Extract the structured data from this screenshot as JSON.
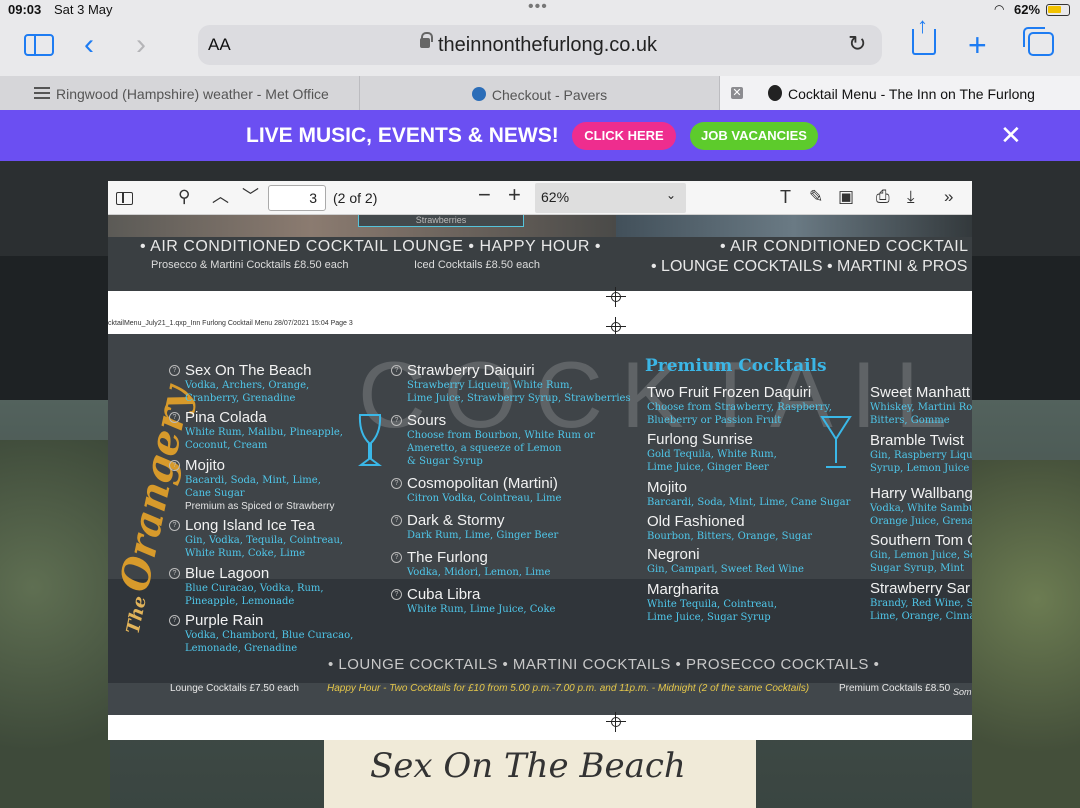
{
  "status": {
    "time": "09:03",
    "date": "Sat 3 May",
    "battery": "62%"
  },
  "browser": {
    "text_size": "AA",
    "url": "theinnonthefurlong.co.uk",
    "tabs": [
      {
        "label": "Ringwood (Hampshire) weather - Met Office"
      },
      {
        "label": "Checkout - Pavers"
      },
      {
        "label": "Cocktail Menu - The Inn on The Furlong"
      }
    ]
  },
  "promo": {
    "title": "LIVE MUSIC, EVENTS & NEWS!",
    "click_here": "CLICK HERE",
    "job_vacancies": "JOB VACANCIES"
  },
  "pdf": {
    "page": "3",
    "page_count": "(2 of 2)",
    "zoom": "62%",
    "slug": "cktailMenu_July21_1.qxp_Inn Furlong Cocktail Menu  28/07/2021  15:04  Page 3",
    "page2": {
      "box_text": "Strawberries",
      "line_left": "• AIR CONDITIONED COCKTAIL LOUNGE • HAPPY HOUR •",
      "sub_left": "Prosecco & Martini Cocktails £8.50 each",
      "sub_mid": "Iced Cocktails £8.50 each",
      "line_right": "• AIR CONDITIONED COCKTAIL LO",
      "line_right2": "• LOUNGE COCKTAILS • MARTINI & PROS"
    },
    "menu": {
      "brand_small": "The",
      "brand_big": "Orangery",
      "watermark": "COCKTAIL LOUN",
      "premium_title": "Premium Cocktails",
      "col1": [
        {
          "name": "Sex On The Beach",
          "desc": "Vodka, Archers, Orange,",
          "desc2": "Cranberry, Grenadine"
        },
        {
          "name": "Pina Colada",
          "desc": "White Rum, Malibu, Pineapple,",
          "desc2": "Coconut, Cream"
        },
        {
          "name": "Mojito",
          "desc": "Bacardi, Soda, Mint, Lime,",
          "desc2": "Cane Sugar",
          "note": "Premium as Spiced or Strawberry"
        },
        {
          "name": "Long Island Ice Tea",
          "desc": "Gin, Vodka, Tequila, Cointreau,",
          "desc2": "White Rum, Coke, Lime"
        },
        {
          "name": "Blue Lagoon",
          "desc": "Blue Curacao, Vodka, Rum,",
          "desc2": "Pineapple, Lemonade"
        },
        {
          "name": "Purple Rain",
          "desc": "Vodka, Chambord, Blue Curacao,",
          "desc2": "Lemonade, Grenadine"
        }
      ],
      "col2": [
        {
          "name": "Strawberry Daiquiri",
          "desc": "Strawberry Liqueur, White Rum,",
          "desc2": "Lime Juice, Strawberry Syrup, Strawberries"
        },
        {
          "name": "Sours",
          "desc": "Choose from Bourbon, White Rum or",
          "desc2": "Ameretto, a squeeze of Lemon",
          "desc3": "& Sugar Syrup"
        },
        {
          "name": "Cosmopolitan (Martini)",
          "desc": "Citron Vodka, Cointreau, Lime"
        },
        {
          "name": "Dark & Stormy",
          "desc": "Dark Rum, Lime, Ginger Beer"
        },
        {
          "name": "The Furlong",
          "desc": "Vodka, Midori, Lemon, Lime"
        },
        {
          "name": "Cuba Libra",
          "desc": "White Rum, Lime Juice, Coke"
        }
      ],
      "col3": [
        {
          "name": "Two Fruit Frozen Daquiri",
          "desc": "Choose from Strawberry, Raspberry,",
          "desc2": "Blueberry or Passion Fruit"
        },
        {
          "name": "Furlong Sunrise",
          "desc": "Gold Tequila, White Rum,",
          "desc2": "Lime Juice, Ginger Beer"
        },
        {
          "name": "Mojito",
          "desc": "Barcardi, Soda, Mint, Lime, Cane Sugar"
        },
        {
          "name": "Old Fashioned",
          "desc": "Bourbon, Bitters, Orange, Sugar"
        },
        {
          "name": "Negroni",
          "desc": "Gin, Campari, Sweet Red Wine"
        },
        {
          "name": "Margharita",
          "desc": "White Tequila, Cointreau,",
          "desc2": "Lime Juice, Sugar Syrup"
        }
      ],
      "col4": [
        {
          "name": "Sweet Manhatt",
          "desc": "Whiskey, Martini Ross",
          "desc2": "Bitters, Gomme"
        },
        {
          "name": "Bramble Twist",
          "desc": "Gin, Raspberry Lique",
          "desc2": "Syrup, Lemon Juice"
        },
        {
          "name": "Harry Wallbang",
          "desc": "Vodka, White Sambu",
          "desc2": "Orange Juice, Grenad"
        },
        {
          "name": "Southern Tom C",
          "desc": "Gin, Lemon Juice, Soc",
          "desc2": "Sugar Syrup, Mint"
        },
        {
          "name": "Strawberry Sar",
          "desc": "Brandy, Red Wine, Str",
          "desc2": "Lime, Orange, Cinnan"
        }
      ],
      "bottom_line": "• LOUNGE COCKTAILS  •  MARTINI COCKTAILS  •  PROSECCO COCKTAILS  •",
      "foot_lounge": "Lounge Cocktails £7.50 each",
      "foot_happy": "Happy Hour - Two Cocktails for £10 from 5.00 p.m.-7.00 p.m. and 11p.m. - Midnight (2 of the same Cocktails)",
      "foot_premium": "Premium Cocktails £8.50",
      "foot_some": "Som"
    }
  },
  "site": {
    "poster_text": "Sex On The Beach"
  },
  "colors": {
    "promo_bg": "#6b4ff2",
    "click_here": "#ee2d8e",
    "job_vacancies": "#5dcb2c",
    "ios_blue": "#1e7cf2",
    "cyan_text": "#4fc7ea"
  }
}
